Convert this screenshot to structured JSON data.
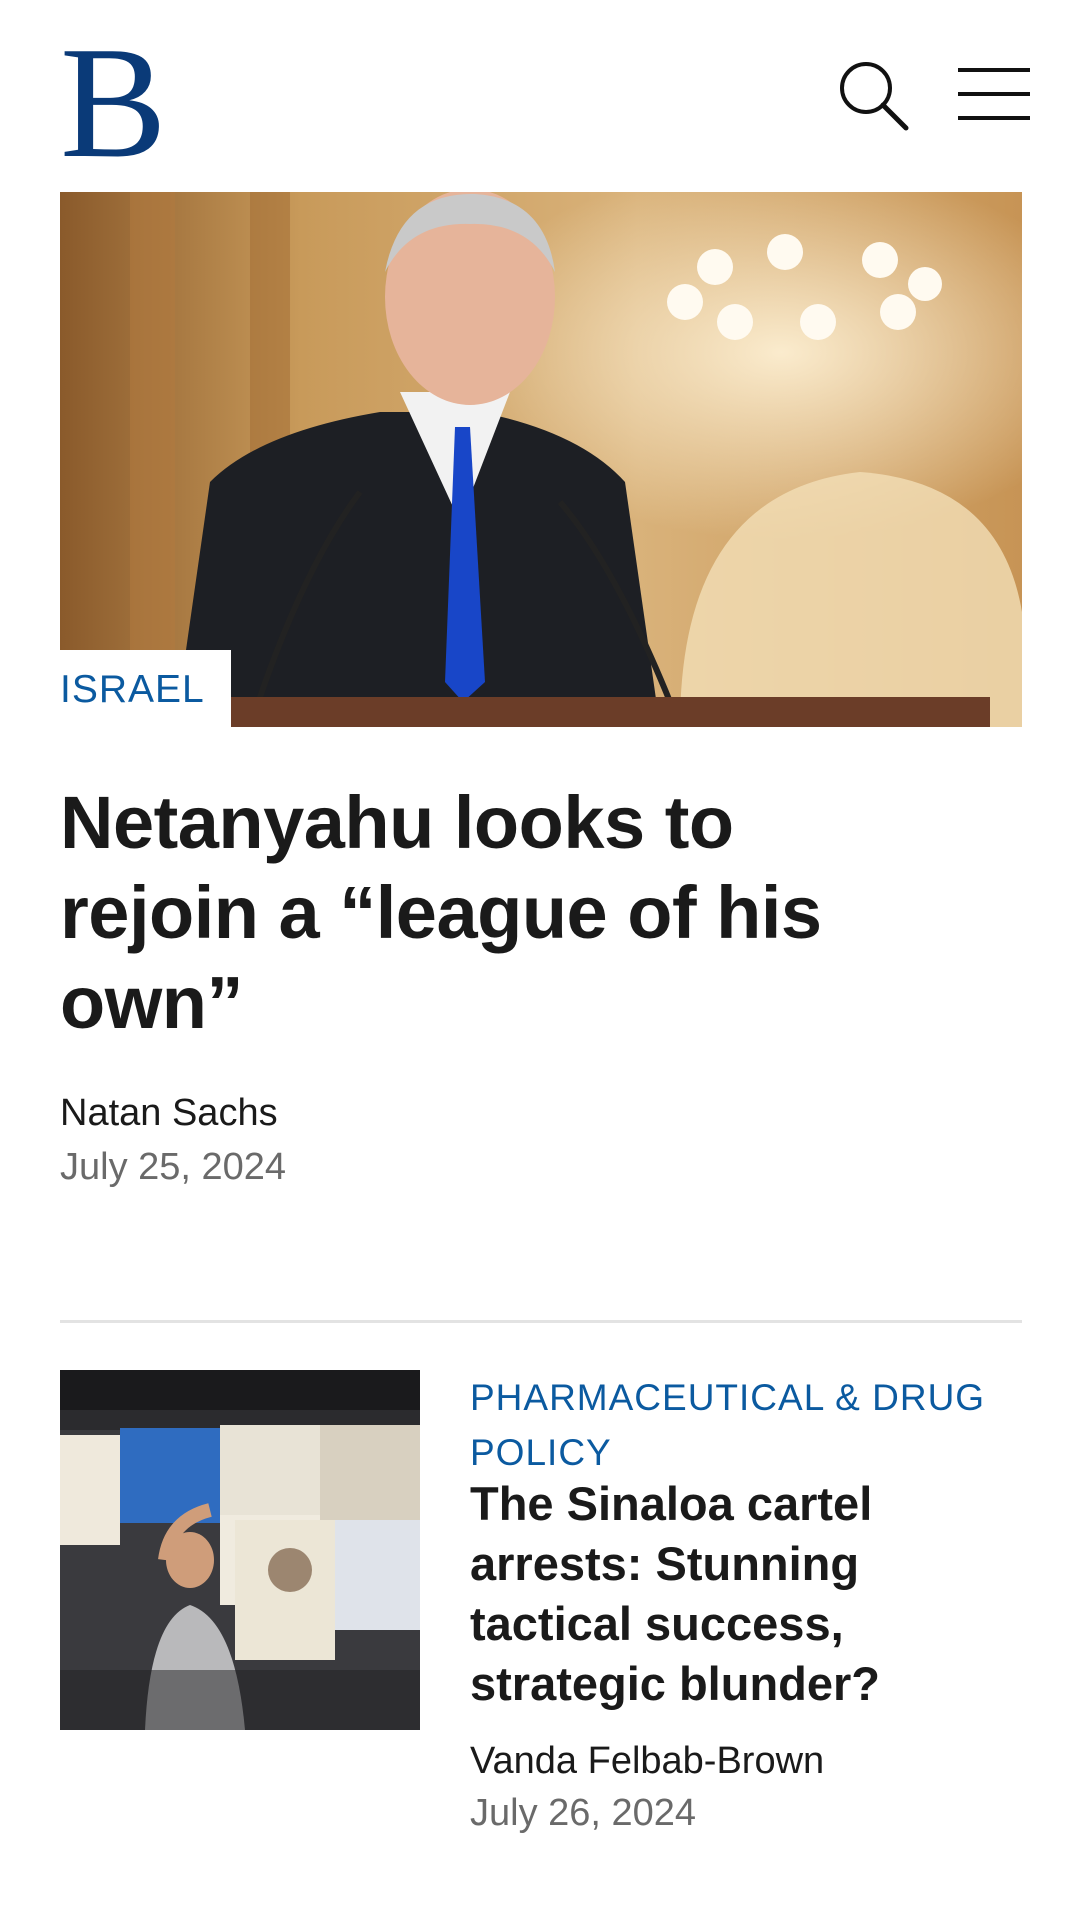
{
  "header": {
    "logo_letter": "B",
    "brand_color": "#0a3a78",
    "search_icon": "search-icon",
    "menu_icon": "hamburger-menu-icon"
  },
  "featured": {
    "category": "ISRAEL",
    "title": "Netanyahu looks to rejoin a “league of his own”",
    "author": "Natan Sachs",
    "date": "July 25, 2024",
    "image_alt": "Man in dark suit and blue tie at a podium"
  },
  "articles": [
    {
      "category": "PHARMACEUTICAL & DRUG POLICY",
      "title": "The Sinaloa cartel arrests: Stunning tactical success, strategic blunder?",
      "author": "Vanda Felbab-Brown",
      "date": "July 26, 2024",
      "image_alt": "Newsstand vendor holding newspapers"
    }
  ],
  "colors": {
    "category": "#0b5aa0",
    "meta_date": "#6a6a6a",
    "divider": "#e3e3e3"
  }
}
